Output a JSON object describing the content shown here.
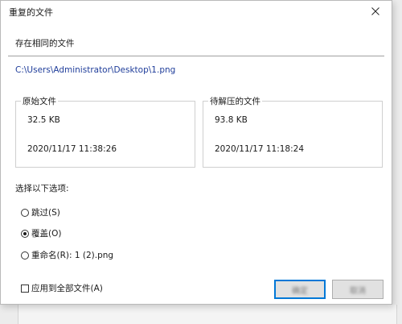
{
  "window": {
    "title": "重复的文件"
  },
  "header": {
    "section_title": "存在相同的文件",
    "file_path": "C:\\Users\\Administrator\\Desktop\\1.png"
  },
  "original_file": {
    "legend": "原始文件",
    "size": "32.5 KB",
    "modified": "2020/11/17 11:38:26"
  },
  "new_file": {
    "legend": "待解压的文件",
    "size": "93.8 KB",
    "modified": "2020/11/17 11:18:24"
  },
  "options": {
    "label": "选择以下选项:",
    "skip": "跳过(S)",
    "overwrite": "覆盖(O)",
    "rename": "重命名(R): 1 (2).png",
    "selected": "overwrite"
  },
  "footer": {
    "apply_all": "应用到全部文件(A)",
    "ok_label": "确定",
    "cancel_label": "取消"
  },
  "colors": {
    "path_link": "#1f3d9a",
    "default_button_border": "#0078d7"
  }
}
